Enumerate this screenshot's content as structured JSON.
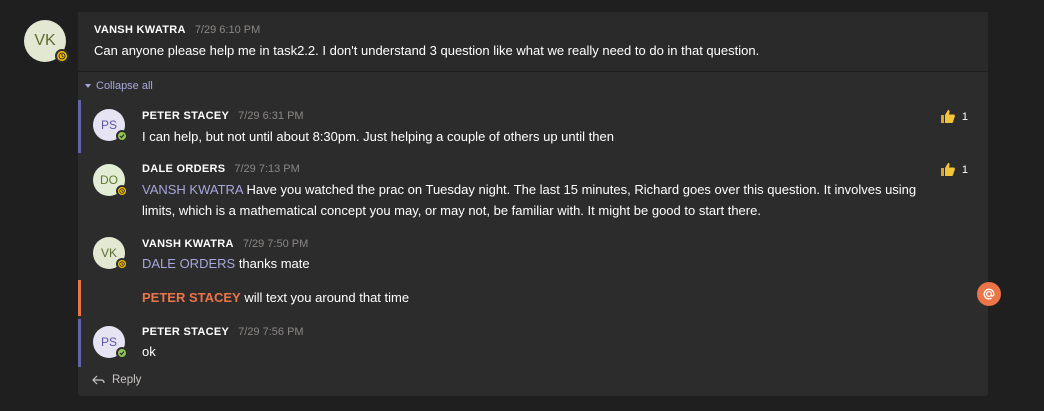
{
  "root": {
    "avatar_initials": "VK",
    "author": "VANSH KWATRA",
    "time": "7/29 6:10 PM",
    "text": "Can anyone please help me in task2.2. I don't understand 3 question like what we really need to do in that question."
  },
  "collapse_label": "Collapse all",
  "replies": [
    {
      "avatar_initials": "PS",
      "author": "PETER STACEY",
      "time": "7/29 6:31 PM",
      "text": "I can help, but not until about 8:30pm. Just helping a couple of others up until then",
      "reaction_count": "1"
    },
    {
      "avatar_initials": "DO",
      "author": "DALE ORDERS",
      "time": "7/29 7:13 PM",
      "mention": "VANSH KWATRA",
      "text_line1": " Have you watched the prac on Tuesday night. The last 15 minutes, Richard goes over this question. It involves using",
      "text_line2": "limits, which is a mathematical concept you may, or may not, be familiar with.  It might be good to start there.",
      "reaction_count": "1"
    },
    {
      "avatar_initials": "VK",
      "author": "VANSH KWATRA",
      "time": "7/29 7:50 PM",
      "mention": "DALE ORDERS",
      "text": " thanks mate"
    },
    {
      "mention": "PETER STACEY",
      "text": " will text you around that time"
    },
    {
      "avatar_initials": "PS",
      "author": "PETER STACEY",
      "time": "7/29 7:56 PM",
      "text": "ok"
    }
  ],
  "reply_label": "Reply",
  "colors": {
    "background": "#1f1f1f",
    "card": "#2d2c2c",
    "accent_purple": "#6264a7",
    "mention": "#a6a7dc",
    "mention_me": "#e97548",
    "status_away": "#fcc400",
    "status_available": "#92c353"
  },
  "icons": {
    "reaction": "thumbs-up-icon",
    "collapse": "caret-down-icon",
    "reply": "reply-arrow-icon",
    "mention_badge": "at-sign-icon"
  }
}
